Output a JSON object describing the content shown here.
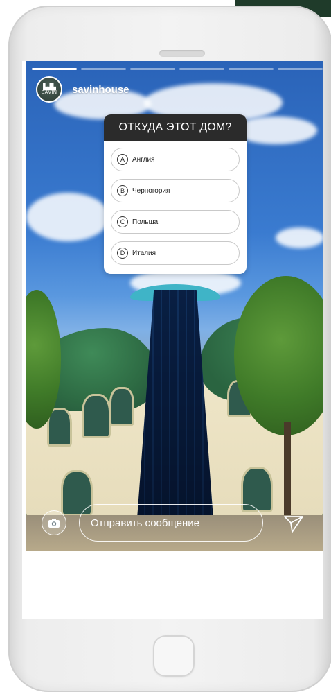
{
  "story": {
    "progress_segments": 6,
    "active_segment": 1,
    "account": {
      "username": "savinhouse",
      "avatar_logo_text": "SAVIN"
    },
    "quiz": {
      "question": "ОТКУДА ЭТОТ ДОМ?",
      "options": [
        {
          "letter": "A",
          "label": "Англия"
        },
        {
          "letter": "B",
          "label": "Черногория"
        },
        {
          "letter": "C",
          "label": "Польша"
        },
        {
          "letter": "D",
          "label": "Италия"
        }
      ]
    },
    "reply": {
      "placeholder": "Отправить сообщение"
    }
  },
  "icons": {
    "camera": "camera-icon",
    "send": "paper-plane-icon"
  },
  "colors": {
    "quiz_header": "#2b2b2b",
    "corner_decoration": "#1f3b2a"
  }
}
